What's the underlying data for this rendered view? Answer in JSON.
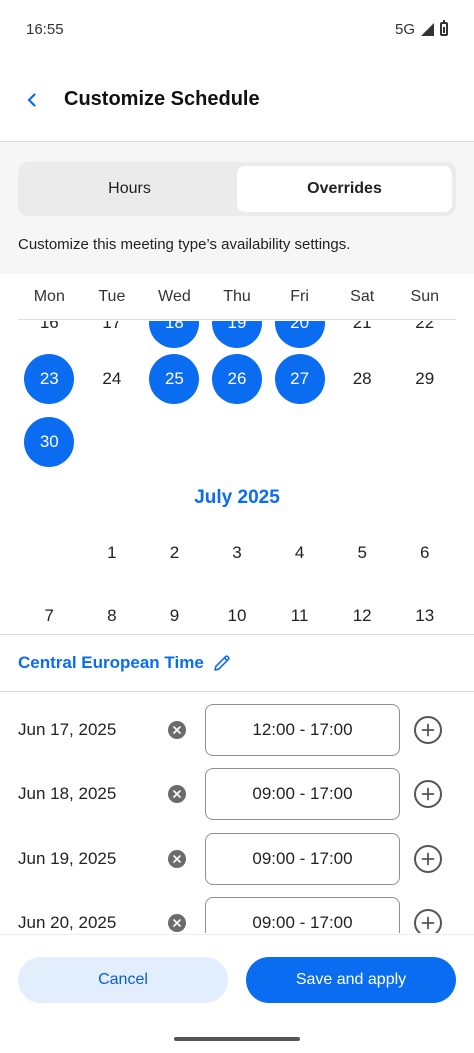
{
  "status_bar": {
    "time": "16:55",
    "network": "5G"
  },
  "header": {
    "title": "Customize Schedule"
  },
  "tabs": [
    {
      "label": "Hours",
      "active": false
    },
    {
      "label": "Overrides",
      "active": true
    }
  ],
  "helper_text": "Customize this meeting type’s availability settings.",
  "weekdays": [
    "Mon",
    "Tue",
    "Wed",
    "Thu",
    "Fri",
    "Sat",
    "Sun"
  ],
  "calendar": {
    "june_partial_row": [
      "16",
      "17",
      "18",
      "19",
      "20",
      "21",
      "22"
    ],
    "june_partial_selected": [
      false,
      false,
      true,
      true,
      true,
      false,
      false
    ],
    "june_row": [
      "23",
      "24",
      "25",
      "26",
      "27",
      "28",
      "29"
    ],
    "june_row_selected": [
      true,
      false,
      true,
      true,
      true,
      false,
      false
    ],
    "june_last_row": [
      "30",
      "",
      "",
      "",
      "",
      "",
      ""
    ],
    "june_last_selected": [
      true,
      false,
      false,
      false,
      false,
      false,
      false
    ],
    "month_title": "July 2025",
    "july_row1": [
      "",
      "1",
      "2",
      "3",
      "4",
      "5",
      "6"
    ],
    "july_row2": [
      "7",
      "8",
      "9",
      "10",
      "11",
      "12",
      "13"
    ]
  },
  "timezone": {
    "label": "Central European Time"
  },
  "overrides": [
    {
      "date": "Jun 17, 2025",
      "time": "12:00 - 17:00"
    },
    {
      "date": "Jun 18, 2025",
      "time": "09:00 - 17:00"
    },
    {
      "date": "Jun 19, 2025",
      "time": "09:00 - 17:00"
    },
    {
      "date": "Jun 20, 2025",
      "time": "09:00 - 17:00"
    }
  ],
  "footer": {
    "cancel_label": "Cancel",
    "save_label": "Save and apply"
  },
  "colors": {
    "accent": "#0a6cf1",
    "cancel_bg": "#e3eefc",
    "grey_band": "#f6f6f7"
  }
}
